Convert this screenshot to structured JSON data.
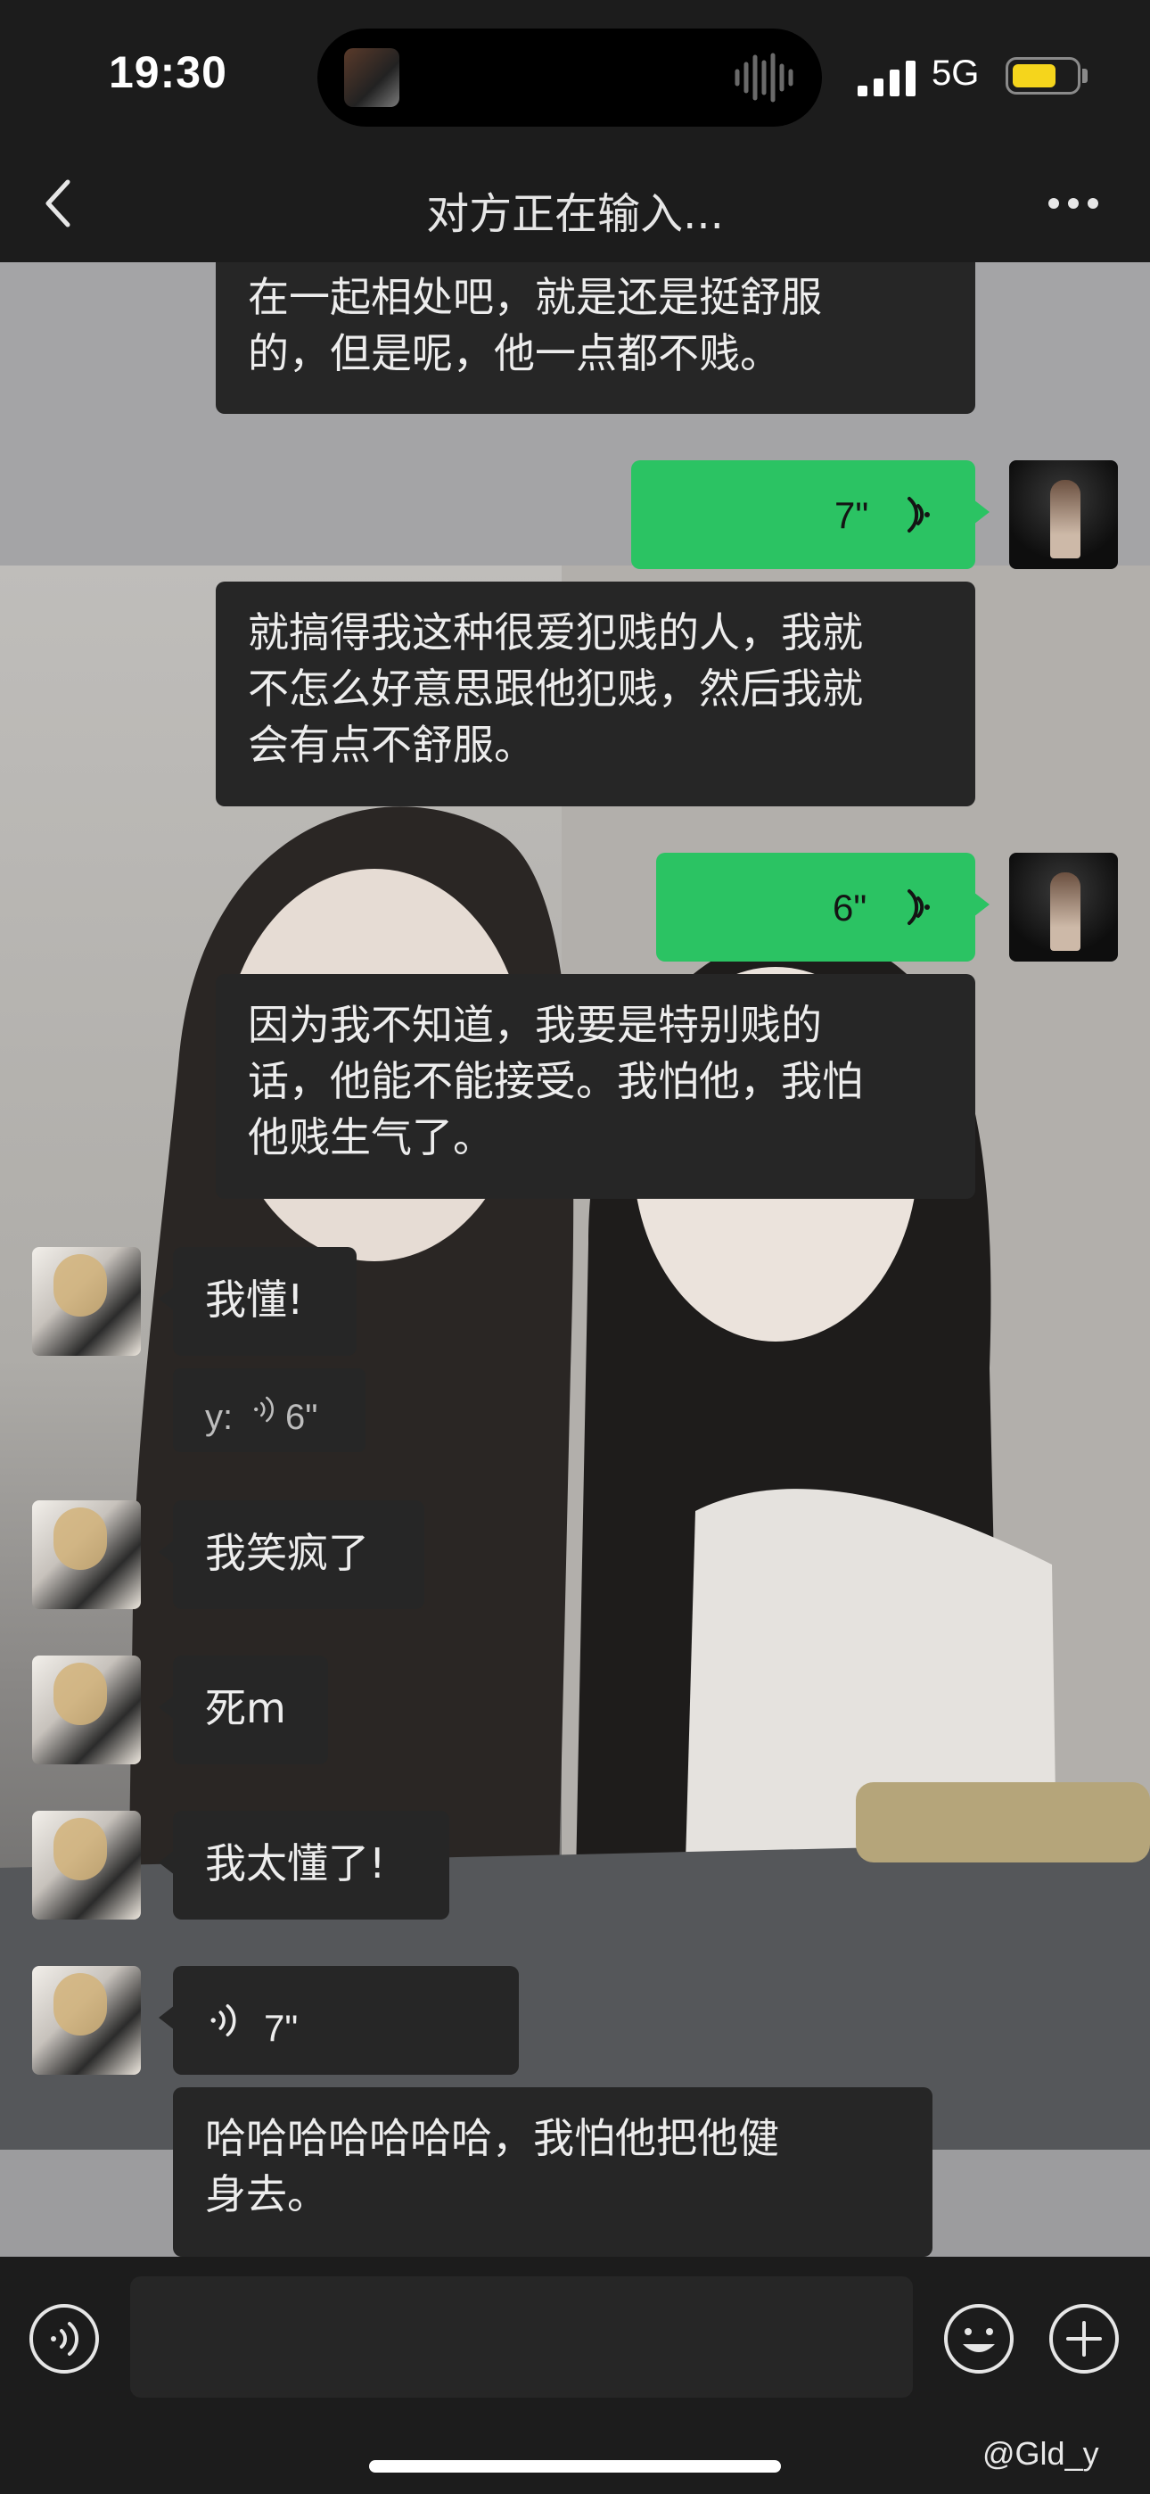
{
  "status_bar": {
    "time": "19:30",
    "network": "5G",
    "battery_color": "#f5d51c"
  },
  "nav": {
    "title": "对方正在输入...",
    "back_icon": "chevron-left-icon",
    "more_icon": "more-dots-icon"
  },
  "colors": {
    "sent_bubble": "#2bc363",
    "received_bubble": "#262626",
    "background": "#1c1c1c"
  },
  "messages": [
    {
      "side": "left",
      "type": "text",
      "text_lines": [
        "在一起相处吧，就是还是挺舒服",
        "的，但是呢，他一点都不贱。"
      ]
    },
    {
      "side": "right",
      "type": "voice",
      "duration": "7\""
    },
    {
      "side": "left",
      "type": "text",
      "text_lines": [
        "就搞得我这种很爱犯贱的人，我就",
        "不怎么好意思跟他犯贱，然后我就",
        "会有点不舒服。"
      ]
    },
    {
      "side": "right",
      "type": "voice",
      "duration": "6\""
    },
    {
      "side": "left",
      "type": "text",
      "text_lines": [
        "因为我不知道，我要是特别贱的",
        "话，他能不能接受。我怕他，我怕",
        "他贱生气了。"
      ]
    },
    {
      "side": "left",
      "type": "text",
      "text": "我懂!"
    },
    {
      "side": "left",
      "type": "voice-quote",
      "prefix": "y:",
      "duration": "6\""
    },
    {
      "side": "left",
      "type": "text",
      "text": "我笑疯了"
    },
    {
      "side": "left",
      "type": "text",
      "text": "死m"
    },
    {
      "side": "left",
      "type": "text",
      "text": "我太懂了!"
    },
    {
      "side": "left",
      "type": "voice",
      "duration": "7\""
    },
    {
      "side": "left",
      "type": "text",
      "text_lines": [
        "哈哈哈哈哈哈哈，我怕他把他健",
        "身去。"
      ]
    }
  ],
  "input_bar": {
    "voice_icon": "voice-icon",
    "emoji_icon": "emoji-icon",
    "plus_icon": "plus-icon"
  },
  "watermark": "@Gld_y"
}
